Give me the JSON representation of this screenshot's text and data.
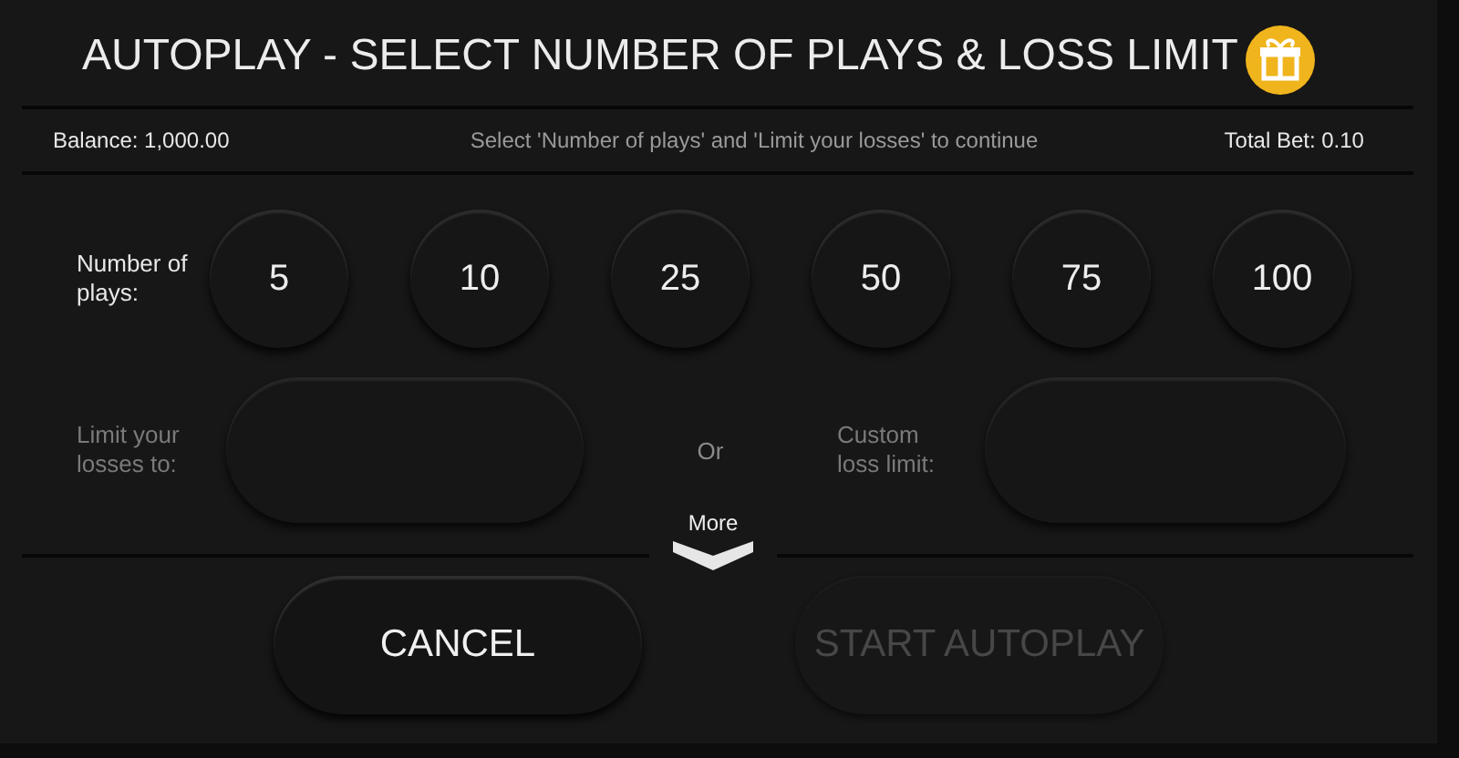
{
  "title": "AUTOPLAY - SELECT NUMBER OF PLAYS & LOSS LIMIT",
  "info_bar": {
    "balance": "Balance: 1,000.00",
    "hint": "Select 'Number of plays' and 'Limit your losses' to continue",
    "total_bet": "Total Bet: 0.10"
  },
  "plays": {
    "label": "Number of plays:",
    "options": [
      {
        "label": "5",
        "selected": false
      },
      {
        "label": "10",
        "selected": false
      },
      {
        "label": "25",
        "selected": false
      },
      {
        "label": "50",
        "selected": false
      },
      {
        "label": "75",
        "selected": false
      },
      {
        "label": "100",
        "selected": false
      }
    ]
  },
  "loss_limit": {
    "label": "Limit your losses to:",
    "disabled": true
  },
  "separator": "Or",
  "custom_loss_limit": {
    "label": "Custom loss limit:",
    "disabled": true
  },
  "more": {
    "label": "More",
    "expanded": false
  },
  "buttons": [
    {
      "label": "CANCEL",
      "disabled": false
    },
    {
      "label": "START AUTOPLAY",
      "disabled": true
    }
  ]
}
